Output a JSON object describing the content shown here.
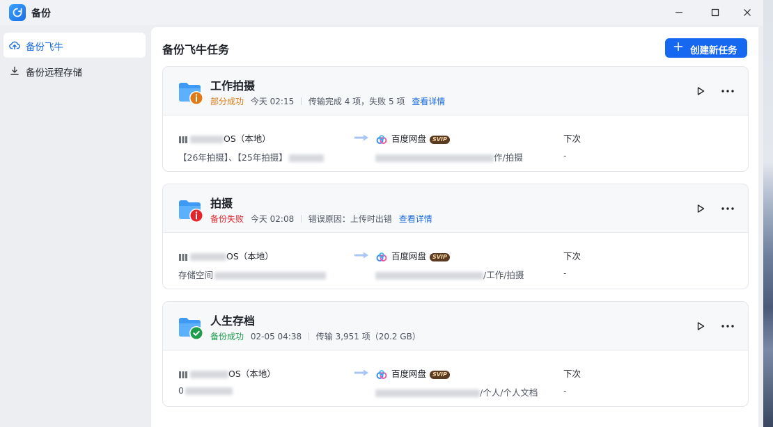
{
  "app": {
    "title": "备份"
  },
  "sidebar": {
    "items": [
      {
        "label": "备份飞牛",
        "icon": "cloud-upload-icon",
        "active": true
      },
      {
        "label": "备份远程存储",
        "icon": "download-icon",
        "active": false
      }
    ]
  },
  "main": {
    "title": "备份飞牛任务",
    "create_button": "创建新任务"
  },
  "tasks": [
    {
      "name": "工作拍摄",
      "status": "部分成功",
      "status_kind": "warning",
      "time": "今天 02:15",
      "detail": "传输完成 4 项，失败 5 项",
      "link": "查看详情",
      "source_label": "OS（本地）",
      "source_path": "【26年拍摄】、【25年拍摄】",
      "target_label": "百度网盘",
      "target_badge": "SVIP",
      "target_path": "作/拍摄",
      "next_label": "下次",
      "next_value": "-"
    },
    {
      "name": "拍摄",
      "status": "备份失败",
      "status_kind": "error",
      "time": "今天 02:08",
      "detail": "错误原因：上传时出错",
      "link": "查看详情",
      "source_label": "OS（本地）",
      "source_path": "存储空间",
      "target_label": "百度网盘",
      "target_badge": "SVIP",
      "target_path": "/工作/拍摄",
      "next_label": "下次",
      "next_value": "-"
    },
    {
      "name": "人生存档",
      "status": "备份成功",
      "status_kind": "success",
      "time": "02-05 04:38",
      "detail": "传输 3,951 项（20.2 GB）",
      "link": "",
      "source_label": "OS（本地）",
      "source_path": "0",
      "target_label": "百度网盘",
      "target_badge": "SVIP",
      "target_path": "/个人/个人文档",
      "next_label": "下次",
      "next_value": "-"
    }
  ],
  "colors": {
    "accent": "#1668f0",
    "warning": "#e07a16",
    "error": "#e5252c",
    "success": "#1f9d4c"
  }
}
